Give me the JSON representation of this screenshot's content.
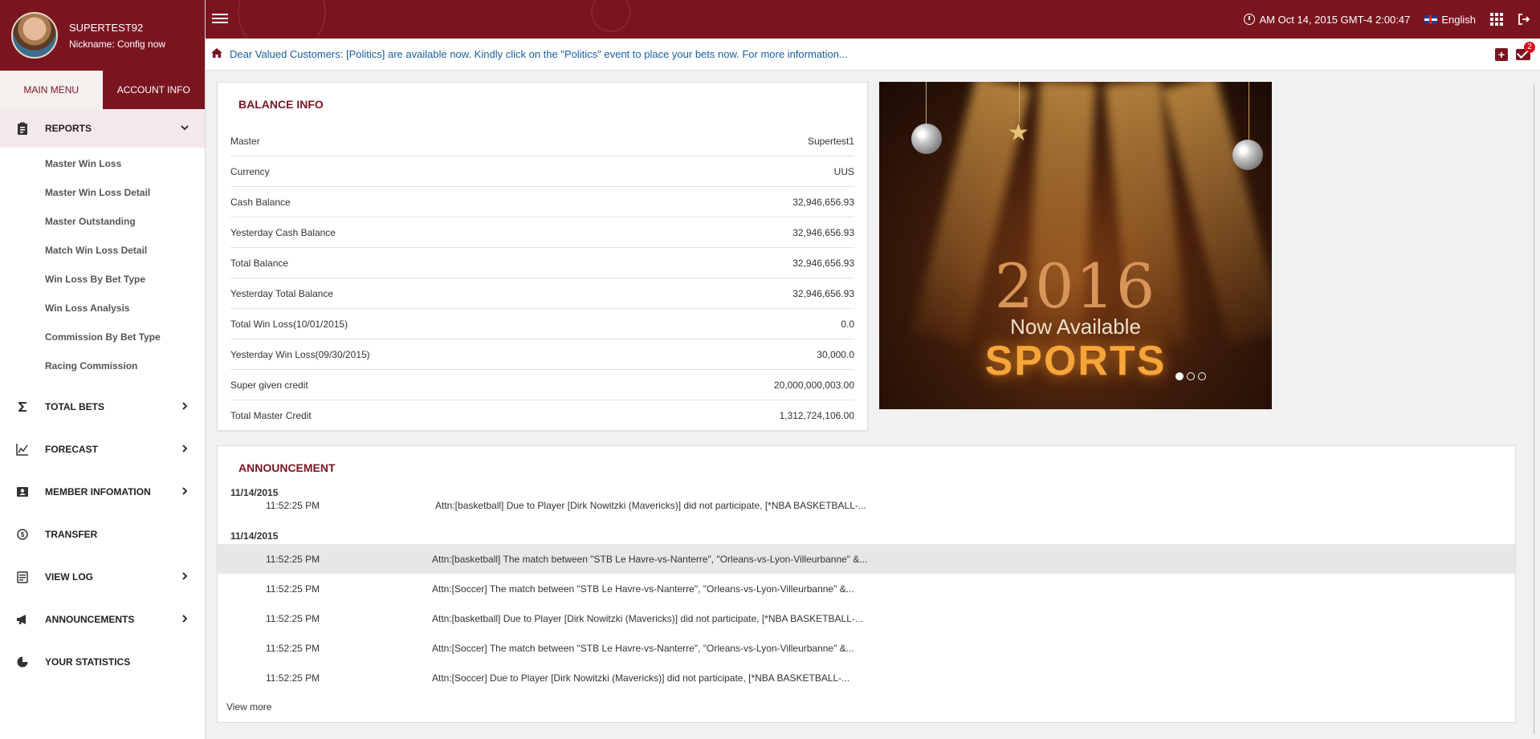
{
  "user": {
    "name": "SUPERTEST92",
    "nickname": "Nickname: Config now"
  },
  "tabs": [
    {
      "label": "MAIN MENU",
      "active": true
    },
    {
      "label": "ACCOUNT INFO",
      "active": false
    }
  ],
  "menu": {
    "reports": {
      "label": "REPORTS",
      "icon": "clipboard-icon",
      "expanded": true
    },
    "report_items": [
      "Master Win Loss",
      "Master Win Loss Detail",
      "Master Outstanding",
      "Match Win Loss Detail",
      "Win Loss By Bet Type",
      "Win Loss Analysis",
      "Commission By Bet Type",
      "Racing Commission"
    ],
    "total_bets": "TOTAL BETS",
    "forecast": "FORECAST",
    "member_info": "MEMBER INFOMATION",
    "transfer": "TRANSFER",
    "view_log": "VIEW LOG",
    "announcements": "ANNOUNCEMENTS",
    "your_statistics": "YOUR STATISTICS"
  },
  "header": {
    "datetime": "AM Oct 14, 2015 GMT-4 2:00:47",
    "language": "English",
    "mail_count": "2"
  },
  "news": "Dear Valued Customers: [Politics] are available now. Kindly click on the \"Politics\" event to place your bets now. For more information...",
  "balance": {
    "title": "BALANCE INFO",
    "rows": [
      {
        "label": "Master",
        "value": "Supertest1"
      },
      {
        "label": "Currency",
        "value": "UUS"
      },
      {
        "label": "Cash Balance",
        "value": "32,946,656.93"
      },
      {
        "label": "Yesterday Cash Balance",
        "value": "32,946,656.93"
      },
      {
        "label": "Total Balance",
        "value": "32,946,656.93"
      },
      {
        "label": "Yesterday Total Balance",
        "value": "32,946,656.93"
      },
      {
        "label": "Total Win Loss(10/01/2015)",
        "value": "0.0"
      },
      {
        "label": "Yesterday Win Loss(09/30/2015)",
        "value": "30,000.0"
      },
      {
        "label": "Super given credit",
        "value": "20,000,000,003.00"
      },
      {
        "label": "Total Master Credit",
        "value": "1,312,724,106.00"
      }
    ]
  },
  "banner": {
    "year": "2016",
    "line1": "Now Available",
    "line2": "SPORTS",
    "slides": 3,
    "active_slide": 1
  },
  "announcement": {
    "title": "ANNOUNCEMENT",
    "groups": [
      {
        "date": "11/14/2015",
        "rows": [
          {
            "time": "11:52:25 PM",
            "text": "Attn:[basketball] Due to Player [Dirk Nowitzki (Mavericks)] did not participate, [*NBA BASKETBALL-..."
          }
        ]
      },
      {
        "date": "11/14/2015",
        "rows": [
          {
            "time": "11:52:25 PM",
            "text": "Attn:[basketball] The match between \"STB Le Havre-vs-Nanterre\", \"Orleans-vs-Lyon-Villeurbanne\" &..."
          },
          {
            "time": "11:52:25 PM",
            "text": "Attn:[Soccer] The match between \"STB Le Havre-vs-Nanterre\", \"Orleans-vs-Lyon-Villeurbanne\" &..."
          },
          {
            "time": "11:52:25 PM",
            "text": "Attn:[basketball] Due to Player [Dirk Nowitzki (Mavericks)] did not participate, [*NBA BASKETBALL-..."
          },
          {
            "time": "11:52:25 PM",
            "text": "Attn:[Soccer] The match between \"STB Le Havre-vs-Nanterre\", \"Orleans-vs-Lyon-Villeurbanne\" &..."
          },
          {
            "time": "11:52:25 PM",
            "text": "Attn:[Soccer] Due to Player [Dirk Nowitzki (Mavericks)] did not participate, [*NBA BASKETBALL-..."
          }
        ]
      }
    ],
    "view_more": "View more"
  },
  "colors": {
    "brand": "#7a1520",
    "link": "#1a5fa0",
    "badge": "#d8101a"
  }
}
